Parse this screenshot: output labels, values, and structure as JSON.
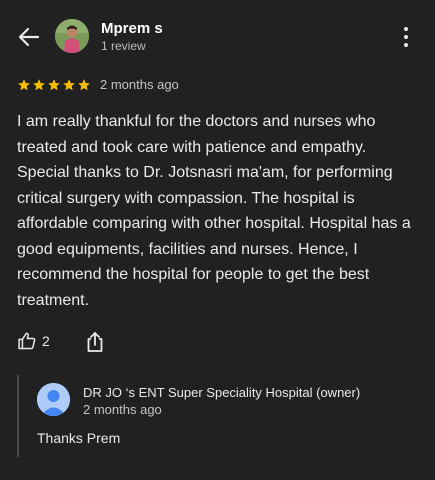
{
  "header": {
    "back_icon": "arrow-left-icon",
    "reviewer_name": "Mprem s",
    "review_count": "1 review",
    "more_icon": "more-vert-icon"
  },
  "review": {
    "rating": 5,
    "max_rating": 5,
    "star_color": "#fbbc04",
    "date": "2 months ago",
    "text": "I am really thankful for the doctors and nurses who treated and took care with patience and empathy. Special thanks to Dr. Jotsnasri ma'am, for performing critical surgery with compassion. The hospital is affordable comparing with other hospital. Hospital has a good equipments, facilities and nurses. Hence, I recommend the hospital for people to get the best treatment."
  },
  "actions": {
    "like_icon": "thumb-up-icon",
    "like_count": "2",
    "share_icon": "share-icon"
  },
  "owner_reply": {
    "name": "DR JO ‘s ENT Super Speciality Hospital (owner)",
    "date": "2 months ago",
    "text": "Thanks Prem",
    "avatar_color": "#aecbfa"
  }
}
